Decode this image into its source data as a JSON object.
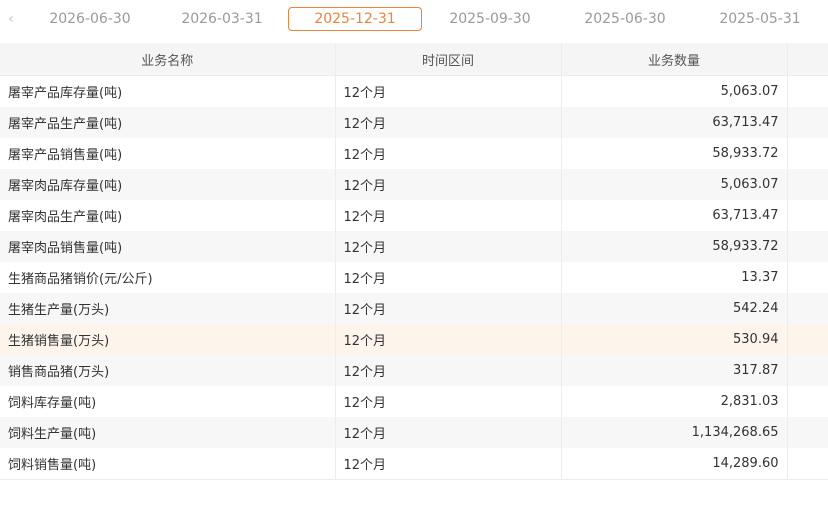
{
  "date_tabs": [
    {
      "label": "2026-06-30",
      "active": false
    },
    {
      "label": "2026-03-31",
      "active": false
    },
    {
      "label": "2025-12-31",
      "active": true
    },
    {
      "label": "2025-09-30",
      "active": false
    },
    {
      "label": "2025-06-30",
      "active": false
    },
    {
      "label": "2025-05-31",
      "active": false
    }
  ],
  "prev_icon": "‹",
  "table": {
    "headers": {
      "name": "业务名称",
      "period": "时间区间",
      "value": "业务数量"
    },
    "rows": [
      {
        "name": "屠宰产品库存量(吨)",
        "period": "12个月",
        "value": "5,063.07"
      },
      {
        "name": "屠宰产品生产量(吨)",
        "period": "12个月",
        "value": "63,713.47"
      },
      {
        "name": "屠宰产品销售量(吨)",
        "period": "12个月",
        "value": "58,933.72"
      },
      {
        "name": "屠宰肉品库存量(吨)",
        "period": "12个月",
        "value": "5,063.07"
      },
      {
        "name": "屠宰肉品生产量(吨)",
        "period": "12个月",
        "value": "63,713.47"
      },
      {
        "name": "屠宰肉品销售量(吨)",
        "period": "12个月",
        "value": "58,933.72"
      },
      {
        "name": "生猪商品猪销价(元/公斤)",
        "period": "12个月",
        "value": "13.37"
      },
      {
        "name": "生猪生产量(万头)",
        "period": "12个月",
        "value": "542.24"
      },
      {
        "name": "生猪销售量(万头)",
        "period": "12个月",
        "value": "530.94",
        "highlight": true
      },
      {
        "name": "销售商品猪(万头)",
        "period": "12个月",
        "value": "317.87"
      },
      {
        "name": "饲料库存量(吨)",
        "period": "12个月",
        "value": "2,831.03"
      },
      {
        "name": "饲料生产量(吨)",
        "period": "12个月",
        "value": "1,134,268.65"
      },
      {
        "name": "饲料销售量(吨)",
        "period": "12个月",
        "value": "14,289.60"
      }
    ]
  },
  "colors": {
    "accent": "#f0823c",
    "header_bg": "#f5f5f5",
    "stripe_bg": "#f7f7f7",
    "highlight_bg": "#fdf4ec"
  }
}
